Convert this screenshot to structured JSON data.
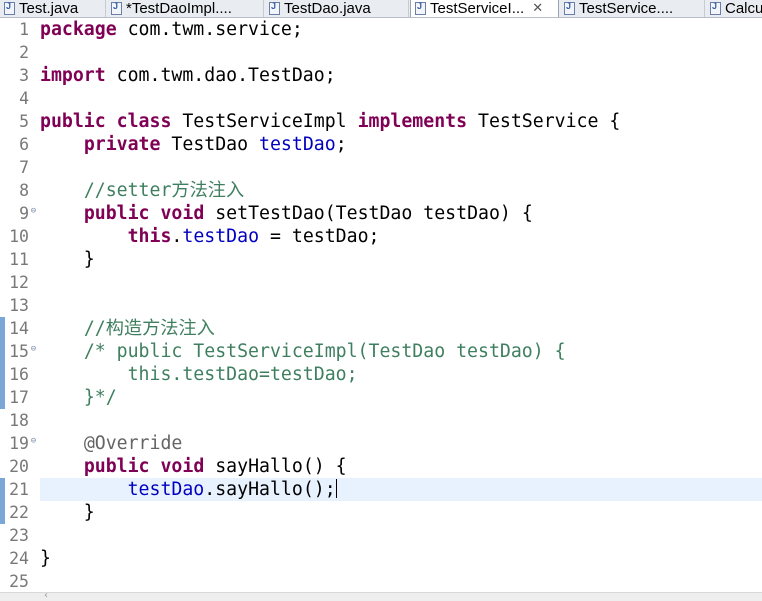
{
  "tabs": [
    {
      "label": "Test.java",
      "icon": "java-file-icon",
      "active": false
    },
    {
      "label": "*TestDaoImpl....",
      "icon": "java-file-icon",
      "active": false
    },
    {
      "label": "TestDao.java",
      "icon": "java-file-icon",
      "active": false
    },
    {
      "label": "TestServiceI...",
      "icon": "java-file-icon",
      "active": true,
      "close": "✕"
    },
    {
      "label": "TestService....",
      "icon": "java-file-icon",
      "active": false
    },
    {
      "label": "Calcu",
      "icon": "java-file-icon",
      "active": false
    }
  ],
  "editor": {
    "lines": [
      {
        "n": "1",
        "tokens": [
          {
            "t": "package",
            "c": "kw"
          },
          {
            "t": " com.twm.service;"
          }
        ]
      },
      {
        "n": "2",
        "tokens": []
      },
      {
        "n": "3",
        "tokens": [
          {
            "t": "import",
            "c": "kw"
          },
          {
            "t": " com.twm.dao.TestDao;"
          }
        ]
      },
      {
        "n": "4",
        "tokens": []
      },
      {
        "n": "5",
        "tokens": [
          {
            "t": "public",
            "c": "kw"
          },
          {
            "t": " "
          },
          {
            "t": "class",
            "c": "kw"
          },
          {
            "t": " TestServiceImpl "
          },
          {
            "t": "implements",
            "c": "kw"
          },
          {
            "t": " TestService {"
          }
        ]
      },
      {
        "n": "6",
        "tokens": [
          {
            "t": "    "
          },
          {
            "t": "private",
            "c": "kw"
          },
          {
            "t": " TestDao "
          },
          {
            "t": "testDao",
            "c": "field"
          },
          {
            "t": ";"
          }
        ]
      },
      {
        "n": "7",
        "tokens": []
      },
      {
        "n": "8",
        "tokens": [
          {
            "t": "    "
          },
          {
            "t": "//setter方法注入",
            "c": "comment"
          }
        ]
      },
      {
        "n": "9",
        "fold": "⊖",
        "tokens": [
          {
            "t": "    "
          },
          {
            "t": "public",
            "c": "kw"
          },
          {
            "t": " "
          },
          {
            "t": "void",
            "c": "kw"
          },
          {
            "t": " setTestDao(TestDao testDao) {"
          }
        ]
      },
      {
        "n": "10",
        "tokens": [
          {
            "t": "        "
          },
          {
            "t": "this",
            "c": "kw"
          },
          {
            "t": "."
          },
          {
            "t": "testDao",
            "c": "field"
          },
          {
            "t": " = testDao;"
          }
        ]
      },
      {
        "n": "11",
        "tokens": [
          {
            "t": "    }"
          }
        ]
      },
      {
        "n": "12",
        "tokens": []
      },
      {
        "n": "13",
        "tokens": []
      },
      {
        "n": "14",
        "ruler": true,
        "tokens": [
          {
            "t": "    "
          },
          {
            "t": "//构造方法注入",
            "c": "comment"
          }
        ]
      },
      {
        "n": "15",
        "fold": "⊖",
        "ruler": true,
        "tokens": [
          {
            "t": "    "
          },
          {
            "t": "/* public TestServiceImpl(TestDao testDao) {",
            "c": "comment"
          }
        ]
      },
      {
        "n": "16",
        "ruler": true,
        "tokens": [
          {
            "t": "        "
          },
          {
            "t": "this.testDao=testDao;",
            "c": "comment"
          }
        ]
      },
      {
        "n": "17",
        "ruler": true,
        "tokens": [
          {
            "t": "    "
          },
          {
            "t": "}*/",
            "c": "comment"
          }
        ]
      },
      {
        "n": "18",
        "tokens": []
      },
      {
        "n": "19",
        "fold": "⊖",
        "tokens": [
          {
            "t": "    "
          },
          {
            "t": "@Override",
            "c": "anno"
          }
        ]
      },
      {
        "n": "20",
        "tokens": [
          {
            "t": "    "
          },
          {
            "t": "public",
            "c": "kw"
          },
          {
            "t": " "
          },
          {
            "t": "void",
            "c": "kw"
          },
          {
            "t": " sayHallo() {"
          }
        ]
      },
      {
        "n": "21",
        "current": true,
        "ruler": true,
        "cursor": true,
        "tokens": [
          {
            "t": "        "
          },
          {
            "t": "testDao",
            "c": "field"
          },
          {
            "t": ".sayHallo();"
          }
        ]
      },
      {
        "n": "22",
        "ruler": true,
        "tokens": [
          {
            "t": "    }"
          }
        ]
      },
      {
        "n": "23",
        "tokens": []
      },
      {
        "n": "24",
        "tokens": [
          {
            "t": "}"
          }
        ]
      },
      {
        "n": "25",
        "tokens": []
      }
    ]
  },
  "scrollbar": {
    "left_arrow": "‹"
  }
}
